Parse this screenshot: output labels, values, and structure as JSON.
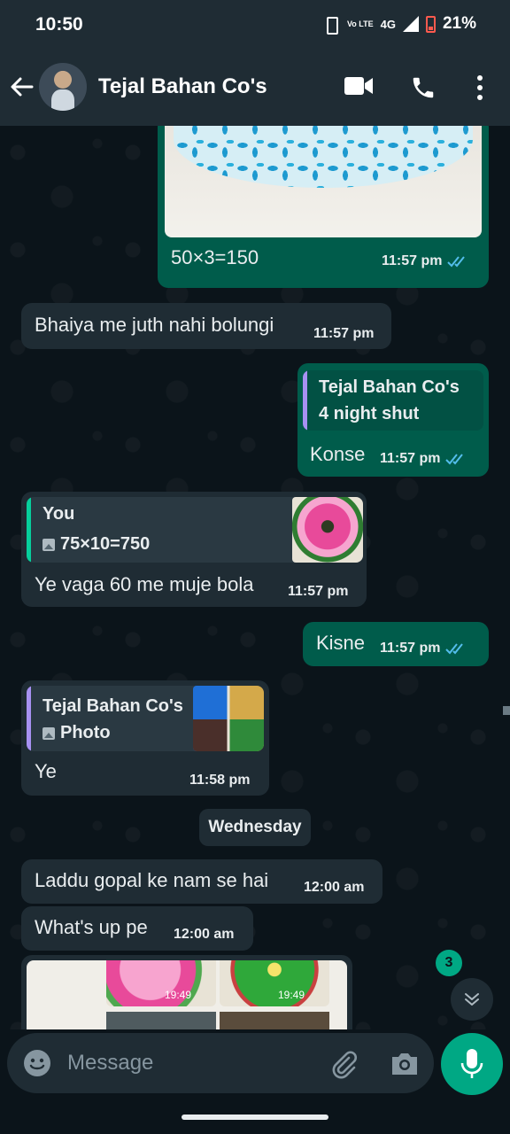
{
  "status_bar": {
    "time": "10:50",
    "volte": "Vo LTE",
    "network": "4G",
    "battery": "21%"
  },
  "header": {
    "contact_name": "Tejal Bahan Co's"
  },
  "messages": {
    "m1": {
      "text": "50×3=150",
      "time": "11:57 pm"
    },
    "m2": {
      "text": "Bhaiya me juth nahi bolungi",
      "time": "11:57 pm"
    },
    "m3": {
      "quote_author": "Tejal Bahan Co's",
      "quote_text": "4 night shut",
      "text": "Konse",
      "time": "11:57 pm"
    },
    "m4": {
      "quote_author": "You",
      "quote_text": "75×10=750",
      "text": "Ye vaga 60 me muje bola",
      "time": "11:57 pm"
    },
    "m5": {
      "text": "Kisne",
      "time": "11:57 pm"
    },
    "m6": {
      "quote_author": "Tejal Bahan Co's",
      "quote_text": "Photo",
      "text": "Ye",
      "time": "11:58 pm"
    },
    "day_divider": "Wednesday",
    "m7": {
      "text": "Laddu gopal ke nam se hai",
      "time": "12:00 am"
    },
    "m8": {
      "text": "What's up pe",
      "time": "12:00 am"
    },
    "m9": {
      "thumb_time_1": "19:49",
      "thumb_time_2": "19:49"
    }
  },
  "unread_count": "3",
  "input": {
    "placeholder": "Message"
  },
  "colors": {
    "outgoing": "#005c4b",
    "incoming": "#1f2c34",
    "accent": "#00a884",
    "read_ticks": "#53bdeb"
  }
}
